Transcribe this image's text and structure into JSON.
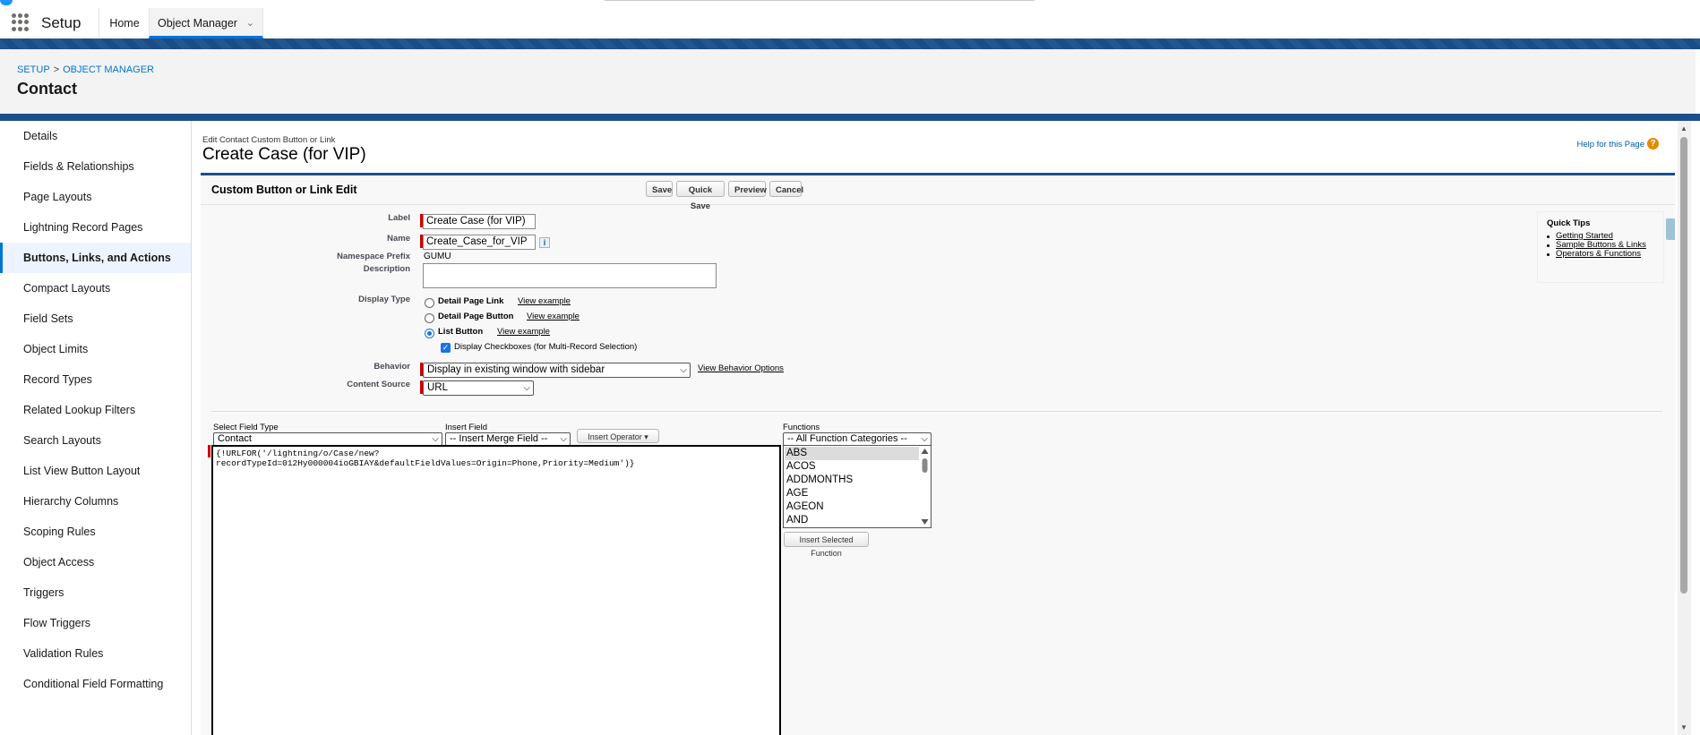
{
  "header": {
    "app_name": "Setup",
    "tabs": [
      {
        "label": "Home"
      },
      {
        "label": "Object Manager"
      }
    ]
  },
  "page": {
    "breadcrumb": {
      "setup": "SETUP",
      "separator": ">",
      "object_manager": "OBJECT MANAGER"
    },
    "title": "Contact"
  },
  "sidebar": {
    "items": [
      {
        "label": "Details"
      },
      {
        "label": "Fields & Relationships"
      },
      {
        "label": "Page Layouts"
      },
      {
        "label": "Lightning Record Pages"
      },
      {
        "label": "Buttons, Links, and Actions",
        "active": true
      },
      {
        "label": "Compact Layouts"
      },
      {
        "label": "Field Sets"
      },
      {
        "label": "Object Limits"
      },
      {
        "label": "Record Types"
      },
      {
        "label": "Related Lookup Filters"
      },
      {
        "label": "Search Layouts"
      },
      {
        "label": "List View Button Layout"
      },
      {
        "label": "Hierarchy Columns"
      },
      {
        "label": "Scoping Rules"
      },
      {
        "label": "Object Access"
      },
      {
        "label": "Triggers"
      },
      {
        "label": "Flow Triggers"
      },
      {
        "label": "Validation Rules"
      },
      {
        "label": "Conditional Field Formatting"
      }
    ]
  },
  "edit": {
    "subtitle": "Edit Contact Custom Button or Link",
    "title": "Create Case (for VIP)",
    "help_link": "Help for this Page",
    "help_icon": "?",
    "section_title": "Custom Button or Link Edit",
    "buttons": {
      "save": "Save",
      "quick_save": "Quick Save",
      "preview": "Preview",
      "cancel": "Cancel"
    },
    "fields": {
      "label_label": "Label",
      "label_value": "Create Case (for VIP)",
      "name_label": "Name",
      "name_value": "Create_Case_for_VIP",
      "info_icon": "i",
      "namespace_label": "Namespace Prefix",
      "namespace_value": "GUMU",
      "description_label": "Description",
      "description_value": "",
      "display_type_label": "Display Type",
      "display_types": [
        {
          "label": "Detail Page Link",
          "link": "View example",
          "selected": false
        },
        {
          "label": "Detail Page Button",
          "link": "View example",
          "selected": false
        },
        {
          "label": "List Button",
          "link": "View example",
          "selected": true
        }
      ],
      "display_checkboxes_label": "Display Checkboxes (for Multi-Record Selection)",
      "behavior_label": "Behavior",
      "behavior_value": "Display in existing window with sidebar",
      "behavior_link": "View Behavior Options",
      "content_source_label": "Content Source",
      "content_source_value": "URL"
    },
    "quick_tips": {
      "title": "Quick Tips",
      "links": [
        "Getting Started",
        "Sample Buttons & Links",
        "Operators & Functions"
      ]
    },
    "formula": {
      "select_field_type_label": "Select Field Type",
      "select_field_type_value": "Contact",
      "insert_field_label": "Insert Field",
      "insert_field_value": "-- Insert Merge Field --",
      "insert_operator_label": "Insert Operator",
      "functions_label": "Functions",
      "functions_category_value": "-- All Function Categories --",
      "functions": [
        "ABS",
        "ACOS",
        "ADDMONTHS",
        "AGE",
        "AGEON",
        "AND"
      ],
      "insert_function_button": "Insert Selected Function",
      "code": "{!URLFOR('/lightning/o/Case/new?\nrecordTypeId=012Hy000004ioGBIAY&defaultFieldValues=Origin=Phone,Priority=Medium')}"
    }
  }
}
